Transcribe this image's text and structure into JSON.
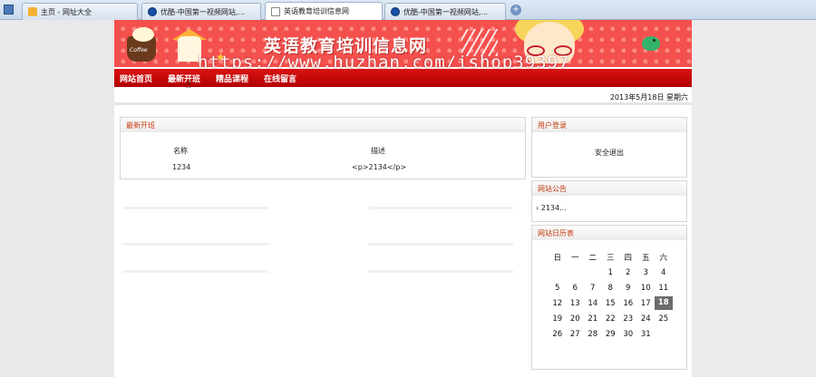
{
  "browser": {
    "tabs": [
      {
        "label": "主页 - 网址大全",
        "icon": "home-icon",
        "active": false
      },
      {
        "label": "优酷-中国第一视频网站,...",
        "icon": "video-icon",
        "active": false
      },
      {
        "label": "英语教育培训信息网",
        "icon": "page-icon",
        "active": true
      },
      {
        "label": "优酷-中国第一视频网站,...",
        "icon": "video-icon",
        "active": false
      }
    ],
    "new_tab": "+"
  },
  "site": {
    "title": "英语教育培训信息网",
    "cup_text": "Coffee",
    "watermark": "https://www.huzhan.com/ishop39397"
  },
  "nav": {
    "items": [
      "网站首页",
      "最新开班",
      "精品课程",
      "在线留言"
    ]
  },
  "date": "2013年5月18日 星期六",
  "main": {
    "title": "最新开班",
    "columns": [
      "名称",
      "描述"
    ],
    "rows": [
      [
        "1234",
        "<p>2134</p>"
      ]
    ]
  },
  "login": {
    "title": "用户登录",
    "logout": "安全退出"
  },
  "notice": {
    "title": "网站公告",
    "item": "2134..."
  },
  "calendar": {
    "title": "网站日历表",
    "weekdays": [
      "日",
      "一",
      "二",
      "三",
      "四",
      "五",
      "六"
    ],
    "weeks": [
      [
        "",
        "",
        "",
        "1",
        "2",
        "3",
        "4"
      ],
      [
        "5",
        "6",
        "7",
        "8",
        "9",
        "10",
        "11"
      ],
      [
        "12",
        "13",
        "14",
        "15",
        "16",
        "17",
        "18"
      ],
      [
        "19",
        "20",
        "21",
        "22",
        "23",
        "24",
        "25"
      ],
      [
        "26",
        "27",
        "28",
        "29",
        "30",
        "31",
        ""
      ]
    ],
    "today": "18"
  },
  "colors": {
    "nav_red": "#c70a0a",
    "banner_red": "#f4504d",
    "panel_title": "#c33a0d"
  }
}
